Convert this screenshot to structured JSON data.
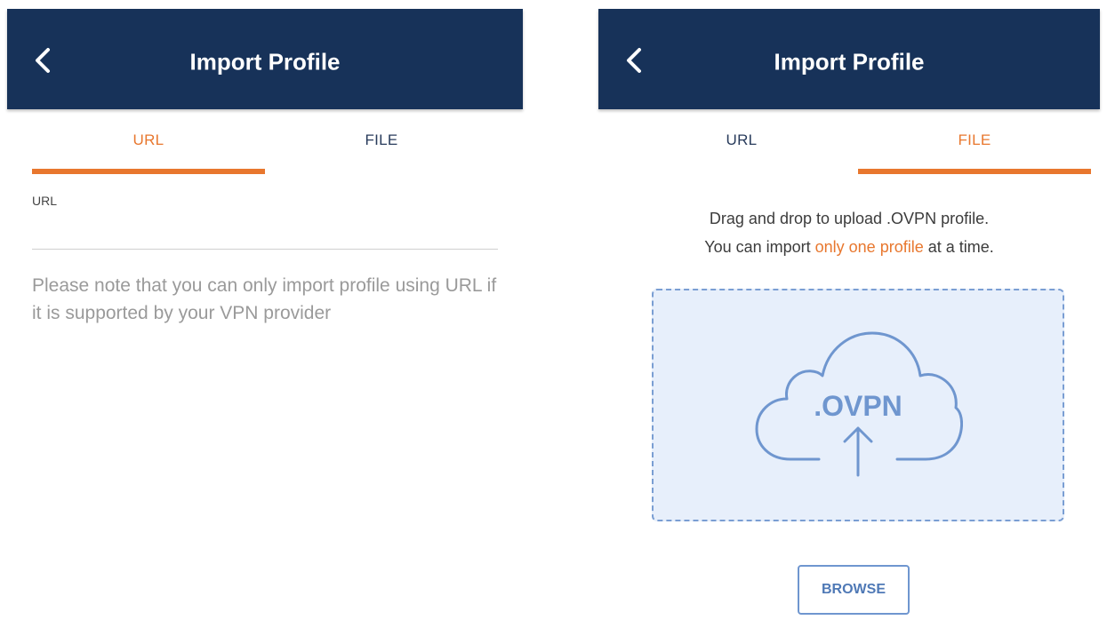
{
  "left_screen": {
    "header": {
      "title": "Import Profile",
      "back_icon": "chevron-left-icon"
    },
    "tabs": [
      {
        "label": "URL",
        "state": "active"
      },
      {
        "label": "FILE",
        "state": "inactive"
      }
    ],
    "url_field": {
      "label": "URL",
      "value": ""
    },
    "note": "Please note that you can only import profile using URL if it is supported by your VPN provider"
  },
  "right_screen": {
    "header": {
      "title": "Import Profile",
      "back_icon": "chevron-left-icon"
    },
    "tabs": [
      {
        "label": "URL",
        "state": "inactive"
      },
      {
        "label": "FILE",
        "state": "active"
      }
    ],
    "instructions": {
      "line1": "Drag and drop to upload .OVPN profile.",
      "line2_prefix": "You can import ",
      "line2_highlight": "only one profile",
      "line2_suffix": " at a time."
    },
    "dropzone": {
      "icon": "cloud-upload-icon",
      "label": ".OVPN"
    },
    "browse_label": "BROWSE"
  },
  "colors": {
    "header_bg": "#173259",
    "accent": "#e8772e",
    "tab_inactive_text": "#283b5b",
    "dropzone_bg": "#e7effb",
    "dropzone_border": "#7a9ed3",
    "icon_blue": "#6f96cf",
    "note_text": "#9a9a9a"
  }
}
